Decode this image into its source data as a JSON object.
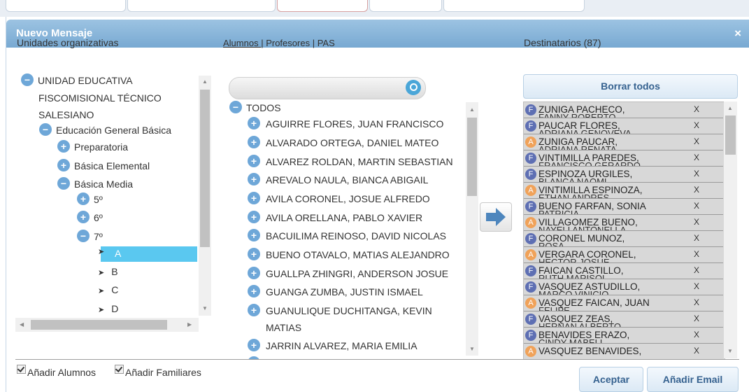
{
  "dialog": {
    "title": "Nuevo Mensaje",
    "close": "×"
  },
  "left": {
    "title": "Unidades organizativas",
    "tree": [
      {
        "label": "UNIDAD EDUCATIVA",
        "toggle": "−"
      },
      {
        "label": "FISCOMISIONAL TÉCNICO"
      },
      {
        "label": "SALESIANO"
      },
      {
        "label": "Educación General Básica",
        "toggle": "−"
      },
      {
        "label": "Preparatoria",
        "toggle": "+"
      },
      {
        "label": "Básica Elemental",
        "toggle": "+"
      },
      {
        "label": "Básica Media",
        "toggle": "−"
      },
      {
        "label": "5º",
        "toggle": "+"
      },
      {
        "label": "6º",
        "toggle": "+"
      },
      {
        "label": "7º",
        "toggle": "−"
      },
      {
        "label": "A",
        "selected": true
      },
      {
        "label": "B"
      },
      {
        "label": "C"
      },
      {
        "label": "D"
      }
    ]
  },
  "middle": {
    "tabs": {
      "alumnos": "Alumnos ",
      "profesores": " Profesores ",
      "pas": " PAS",
      "separator": "|"
    },
    "search_placeholder": "",
    "root_label": "TODOS",
    "students": [
      "AGUIRRE FLORES, JUAN FRANCISCO",
      "ALVARADO ORTEGA, DANIEL MATEO",
      "ALVAREZ ROLDAN, MARTIN SEBASTIAN",
      "AREVALO NAULA, BIANCA ABIGAIL",
      "AVILA CORONEL, JOSUE ALFREDO",
      "AVILA ORELLANA, PABLO XAVIER",
      "BACUILIMA REINOSO, DAVID NICOLAS",
      "BUENO OTAVALO, MATIAS ALEJANDRO",
      "GUALLPA ZHINGRI, ANDERSON JOSUE",
      "GUANGA ZUMBA, JUSTIN ISMAEL",
      "GUANULIQUE DUCHITANGA, KEVIN",
      "MATIAS",
      "JARRIN ALVAREZ, MARIA EMILIA"
    ]
  },
  "right": {
    "title": "Destinatarios (87)",
    "clear_all": "Borrar todos",
    "remove_label": "X",
    "recipients": [
      {
        "type": "F",
        "name": "ZUNIGA PACHECO,",
        "cut": "FANNY ROBERTO"
      },
      {
        "type": "F",
        "name": "PAUCAR FLORES,",
        "cut": "ADRIANA GENOVEVA"
      },
      {
        "type": "A",
        "name": "ZUNIGA PAUCAR,",
        "cut": "ADRIANA RENATA"
      },
      {
        "type": "F",
        "name": "VINTIMILLA PAREDES,",
        "cut": "FRANCISCO GERARDO"
      },
      {
        "type": "F",
        "name": "ESPINOZA URGILES,",
        "cut": "BLANCA NAOMI"
      },
      {
        "type": "A",
        "name": "VINTIMILLA ESPINOZA,",
        "cut": "ETHAN ANDRES"
      },
      {
        "type": "F",
        "name": "BUENO FARFAN, SONIA",
        "cut": "PATRICIA"
      },
      {
        "type": "A",
        "name": "VILLAGOMEZ BUENO,",
        "cut": "NAYELI ANTONELLA"
      },
      {
        "type": "F",
        "name": "CORONEL MUNOZ,",
        "cut": "ROSA"
      },
      {
        "type": "A",
        "name": "VERGARA CORONEL,",
        "cut": "HECTOR JOSUE"
      },
      {
        "type": "F",
        "name": "FAICAN CASTILLO,",
        "cut": "RUTH MARISOL"
      },
      {
        "type": "F",
        "name": "VASQUEZ ASTUDILLO,",
        "cut": "MARCO VINICIO"
      },
      {
        "type": "A",
        "name": "VASQUEZ FAICAN, JUAN",
        "cut": "FELIPE"
      },
      {
        "type": "F",
        "name": "VASQUEZ ZEAS,",
        "cut": "HERNAN ALBERTO"
      },
      {
        "type": "F",
        "name": "BENAVIDES ERAZO,",
        "cut": "CINDY MABELL"
      },
      {
        "type": "A",
        "name": "VASQUEZ BENAVIDES,",
        "cut": ""
      }
    ]
  },
  "footer": {
    "add_students": "Añadir Alumnos",
    "add_family": "Añadir Familiares",
    "accept": "Aceptar",
    "add_email": "Añadir Email"
  },
  "colors": {
    "titlebar": "#84b2d8",
    "toggle": "#6ea7d8",
    "accent_text": "#35618f",
    "badge_f": "#5e6fb3",
    "badge_a": "#f0a259",
    "selected": "#5ac8f0"
  }
}
